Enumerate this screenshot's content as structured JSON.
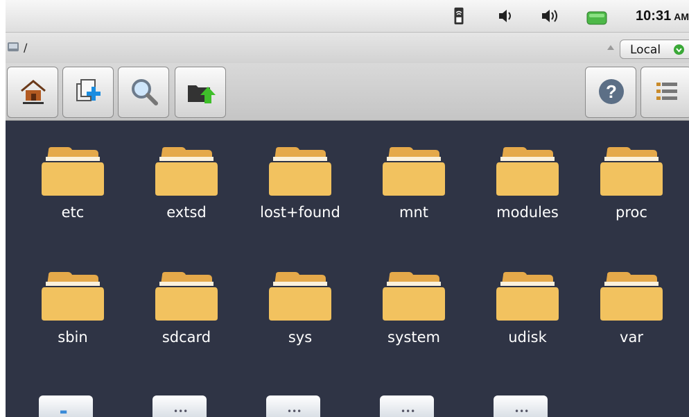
{
  "status_bar": {
    "time": "10:31",
    "ampm": "AM",
    "icons": [
      "sim-card-icon",
      "speaker-icon",
      "speaker-loud-icon",
      "battery-icon"
    ]
  },
  "path_bar": {
    "path": "/",
    "location": "Local"
  },
  "toolbar": {
    "buttons": [
      "home-icon",
      "new-folder-icon",
      "search-icon",
      "upload-folder-icon",
      "help-icon",
      "list-view-icon"
    ]
  },
  "files": [
    {
      "name": "etc"
    },
    {
      "name": "extsd"
    },
    {
      "name": "lost+found"
    },
    {
      "name": "mnt"
    },
    {
      "name": "modules"
    },
    {
      "name": "proc"
    },
    {
      "name": "sbin"
    },
    {
      "name": "sdcard"
    },
    {
      "name": "sys"
    },
    {
      "name": "system"
    },
    {
      "name": "udisk"
    },
    {
      "name": "var"
    }
  ],
  "colors": {
    "grid_background": "#2f3445",
    "folder": "#f2c25f",
    "accent_green": "#3aa837"
  }
}
